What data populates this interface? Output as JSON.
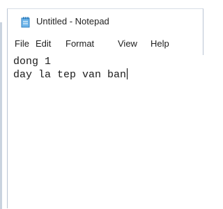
{
  "window": {
    "title": "Untitled - Notepad",
    "icon": "notepad-icon"
  },
  "menu": {
    "file": "File",
    "edit": "Edit",
    "format": "Format",
    "view": "View",
    "help": "Help"
  },
  "editor": {
    "lines": [
      "dong 1",
      "day la tep van ban"
    ]
  },
  "colors": {
    "frame": "#c9d3df",
    "text": "#1a1a1a",
    "icon": "#2f8fd6"
  }
}
